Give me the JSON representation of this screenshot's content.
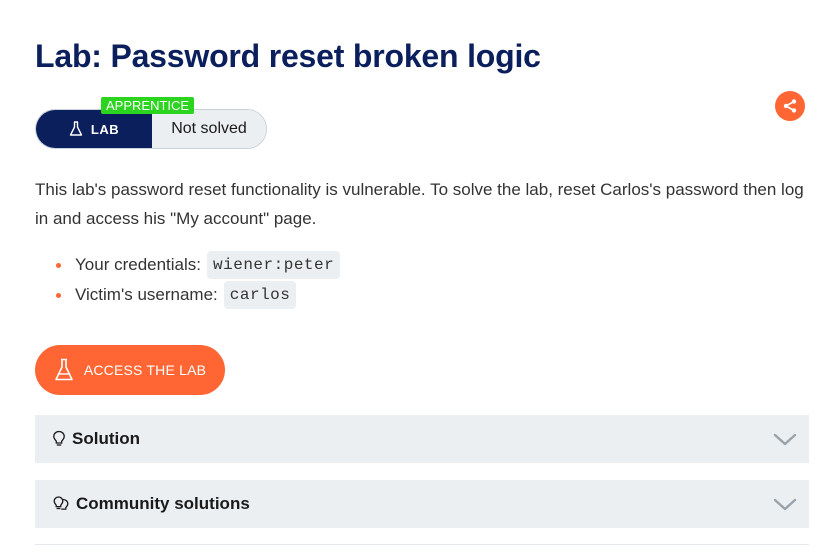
{
  "page": {
    "title": "Lab: Password reset broken logic"
  },
  "status": {
    "level_badge": "APPRENTICE",
    "lab_label": "LAB",
    "state": "Not solved"
  },
  "description": "This lab's password reset functionality is vulnerable. To solve the lab, reset Carlos's password then log in and access his \"My account\" page.",
  "details": [
    {
      "label": "Your credentials:",
      "value": "wiener:peter"
    },
    {
      "label": "Victim's username:",
      "value": "carlos"
    }
  ],
  "actions": {
    "access_label": "ACCESS THE LAB"
  },
  "accordions": [
    {
      "label": "Solution",
      "icon": "lightbulb-icon"
    },
    {
      "label": "Community solutions",
      "icon": "community-lightbulbs-icon"
    }
  ],
  "colors": {
    "title": "#0a1f5c",
    "accent": "#ff6633",
    "badge": "#2bd41f",
    "panel": "#ebeff2"
  }
}
